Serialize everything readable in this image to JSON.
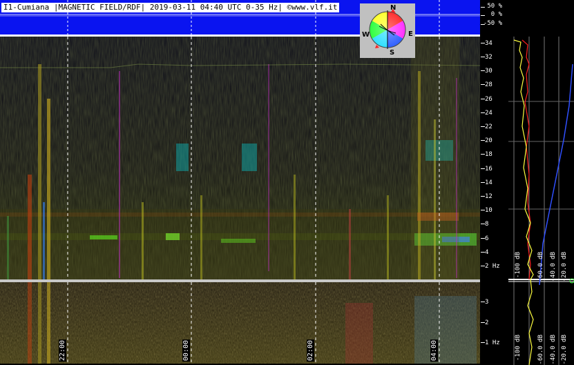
{
  "header": {
    "title": "I1-Cumiana |MAGNETIC FIELD/RDF| 2019-03-11 04:40 UTC 0-35 Hz| ©www.vlf.it",
    "percent_labels": [
      "50 %",
      "0 %",
      "-50 %"
    ]
  },
  "compass": {
    "north": "N",
    "south": "S",
    "east": "E",
    "west": "W"
  },
  "frequency_axis": {
    "main_labels": [
      "34",
      "32",
      "30",
      "28",
      "26",
      "24",
      "22",
      "20",
      "18",
      "16",
      "14",
      "12",
      "10",
      "8",
      "6",
      "4",
      "2 Hz"
    ],
    "lower_labels": [
      "3",
      "2",
      "1 Hz"
    ]
  },
  "time_axis": {
    "labels": [
      "22:00",
      "00:00",
      "02:00",
      "04:00"
    ]
  },
  "level_axis": {
    "labels": [
      "-100 dB",
      "-60.0 dB",
      "-40.0 dB",
      "-20.0 dB"
    ]
  },
  "colors": {
    "header_blue": "#0a14f0",
    "trace_yellow": "#ffff40",
    "trace_red": "#ff2020",
    "trace_blue": "#3050ff"
  }
}
